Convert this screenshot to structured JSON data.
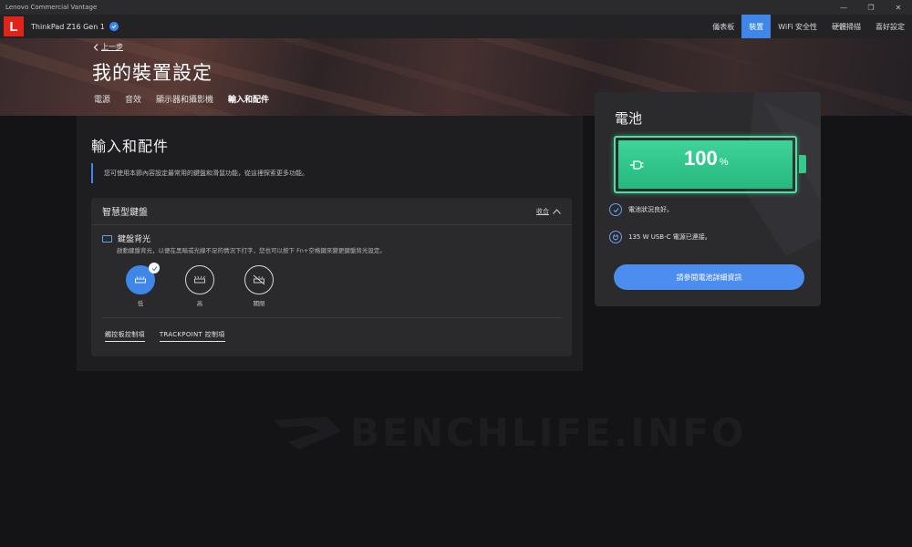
{
  "window": {
    "title": "Lenovo Commercial Vantage",
    "controls": [
      "—",
      "❐",
      "✕"
    ]
  },
  "header": {
    "logo_letter": "L",
    "device": "ThinkPad Z16 Gen 1",
    "nav": [
      {
        "label": "儀表板",
        "active": false
      },
      {
        "label": "裝置",
        "active": true
      },
      {
        "label": "WiFi 安全性",
        "active": false
      },
      {
        "label": "硬體掃描",
        "active": false
      },
      {
        "label": "喜好設定",
        "active": false
      }
    ]
  },
  "hero": {
    "back": "上一步",
    "title": "我的裝置設定",
    "tabs": [
      {
        "label": "電源",
        "active": false
      },
      {
        "label": "音效",
        "active": false
      },
      {
        "label": "顯示器和攝影機",
        "active": false
      },
      {
        "label": "輸入和配件",
        "active": true
      }
    ]
  },
  "main": {
    "section_title": "輸入和配件",
    "section_desc": "您可使用本節內容設定最常用的鍵盤和滑鼠功能，從這裡探索更多功能。",
    "keyboard_card": {
      "title": "智慧型鍵盤",
      "collapse": "收合",
      "backlight_label": "鍵盤背光",
      "backlight_desc": "啟動鍵盤背光，以便在黑暗或光線不足的情況下打字，您也可以按下 Fn+空格鍵來變更鍵盤背光設定。",
      "levels": [
        {
          "label": "低",
          "selected": true
        },
        {
          "label": "高",
          "selected": false
        },
        {
          "label": "關閉",
          "selected": false
        }
      ],
      "links": [
        "觸控板控制項",
        "TRACKPOINT 控制項"
      ]
    }
  },
  "battery": {
    "title": "電池",
    "percent": "100",
    "percent_sign": "%",
    "level": 1.0,
    "status": "電池狀況良好。",
    "power": "135 W USB-C 電源已連接。",
    "button": "請參閱電池詳細資訊",
    "colors": {
      "accent": "#3e86e8",
      "battery_fill": "#2fc88a"
    }
  },
  "watermark": "BENCHLIFE.INFO"
}
